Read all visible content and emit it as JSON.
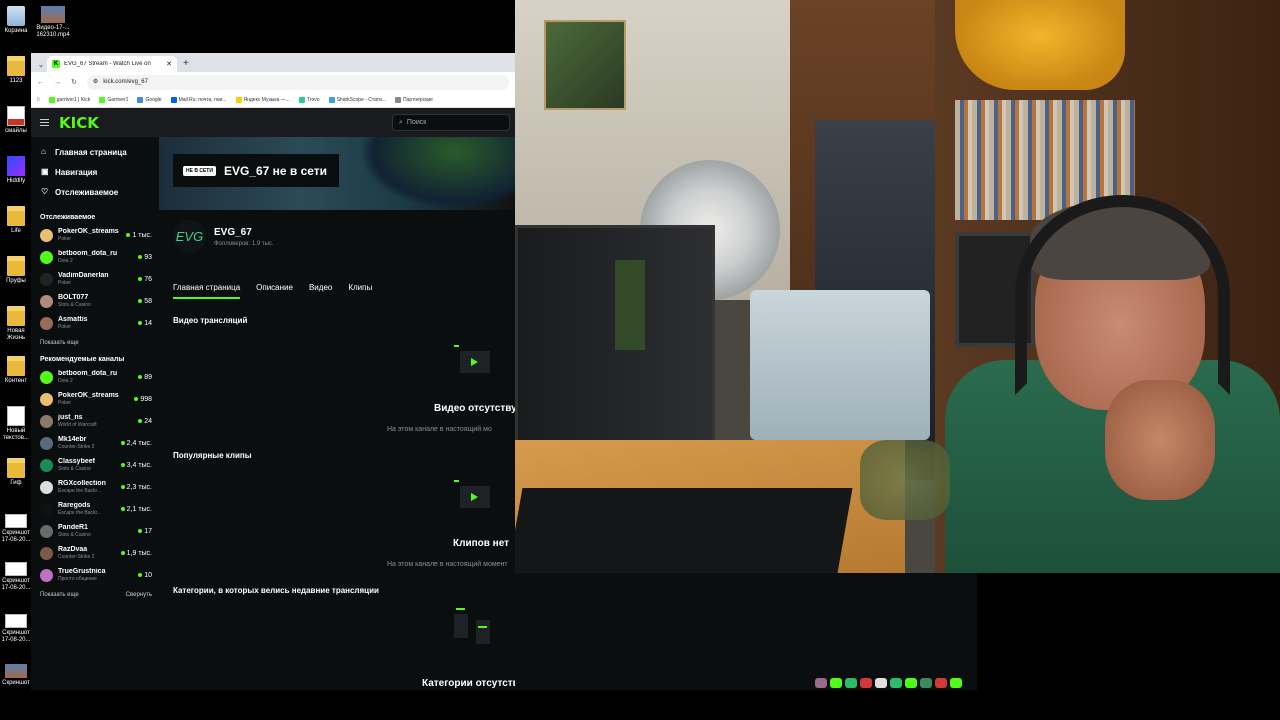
{
  "desktop": {
    "icons": [
      {
        "label": "Корзина"
      },
      {
        "label": "Видео-17-...\n162310.mp4"
      },
      {
        "label": "1123"
      },
      {
        "label": "смайлы"
      },
      {
        "label": "Hiddify"
      },
      {
        "label": "Life"
      },
      {
        "label": "Пруфы"
      },
      {
        "label": "Новая\nЖизнь"
      },
      {
        "label": "Контент"
      },
      {
        "label": "Новый\nтекстов..."
      },
      {
        "label": "Гиф"
      },
      {
        "label": "Скриншот\n17-08-20..."
      },
      {
        "label": "Скриншот\n17-08-20..."
      },
      {
        "label": "Скриншот\n17-08-20..."
      },
      {
        "label": "Скриншот"
      }
    ]
  },
  "browser": {
    "tab_title": "EVG_67 Stream - Watch Live on",
    "url": "kick.com/evg_67",
    "bookmarks": [
      "garrtver1 | Kick",
      "Garrtver1",
      "Google",
      "Mail.Ru: почта, пои...",
      "Яндекс Музыка —...",
      "Trovo",
      "SharkScope - Стати...",
      "Партнерские"
    ]
  },
  "kick": {
    "logo": "KICK",
    "search_placeholder": "Поиск",
    "nav": [
      {
        "label": "Главная страница",
        "icon": "home-icon"
      },
      {
        "label": "Навигация",
        "icon": "compass-icon"
      },
      {
        "label": "Отслеживаемое",
        "icon": "heart-icon"
      }
    ],
    "following_title": "Отслеживаемое",
    "following": [
      {
        "name": "PokerOK_streams",
        "category": "Poker",
        "viewers": "1 тыс.",
        "color": "#e8c070"
      },
      {
        "name": "betboom_dota_ru",
        "category": "Dota 2",
        "viewers": "93",
        "color": "#53fc18"
      },
      {
        "name": "VadimDanerlan",
        "category": "Poker",
        "viewers": "76",
        "color": "#222"
      },
      {
        "name": "BOLT077",
        "category": "Slots & Casino",
        "viewers": "58",
        "color": "#b08a7a"
      },
      {
        "name": "Asmattis",
        "category": "Poker",
        "viewers": "14",
        "color": "#9a6a5a"
      }
    ],
    "show_more": "Показать еще",
    "recommended_title": "Рекомендуемые каналы",
    "recommended": [
      {
        "name": "betboom_dota_ru",
        "category": "Dota 2",
        "viewers": "89",
        "color": "#53fc18"
      },
      {
        "name": "PokerOK_streams",
        "category": "Poker",
        "viewers": "998",
        "color": "#e8c070"
      },
      {
        "name": "just_ns",
        "category": "World of Warcraft",
        "viewers": "24",
        "color": "#8a7a6a"
      },
      {
        "name": "Mk14ebr",
        "category": "Counter-Strike 2",
        "viewers": "2,4 тыс.",
        "color": "#5a6a7a"
      },
      {
        "name": "Classybeef",
        "category": "Slots & Casino",
        "viewers": "3,4 тыс.",
        "color": "#1a8a5a"
      },
      {
        "name": "RGXcollection",
        "category": "Escape the Backr...",
        "viewers": "2,3 тыс.",
        "color": "#ddd"
      },
      {
        "name": "Raregods",
        "category": "Escape the Backr...",
        "viewers": "2,1 тыс.",
        "color": "#111"
      },
      {
        "name": "PandeR1",
        "category": "Slots & Casino",
        "viewers": "17",
        "color": "#6a6a6a"
      },
      {
        "name": "RazDvaa",
        "category": "Counter-Strike 2",
        "viewers": "1,9 тыс.",
        "color": "#7a5a4a"
      },
      {
        "name": "TrueGrustnica",
        "category": "Просто общение",
        "viewers": "10",
        "color": "#c070c0"
      }
    ],
    "show_more2": "Показать еще",
    "collapse": "Свернуть",
    "offline_badge": "НЕ В СЕТИ",
    "offline_text": "EVG_67 не в сети",
    "channel_avatar_text": "EVG",
    "channel_name": "EVG_67",
    "followers": "Фолловеров: 1,9 тыс.",
    "tabs": [
      "Главная страница",
      "Описание",
      "Видео",
      "Клипы"
    ],
    "videos_title": "Видео трансляций",
    "videos_empty": "Видео отсутству",
    "videos_empty_sub": "На этом канале в настоящий мо",
    "clips_title": "Популярные клипы",
    "clips_empty": "Клипов нет",
    "clips_empty_sub": "На этом канале в настоящий момент",
    "categories_title": "Категории, в которых велись недавние трансляции",
    "categories_empty": "Категории отсутствуют"
  },
  "colors": {
    "accent": "#53fc18",
    "bg": "#0b0e0f"
  }
}
